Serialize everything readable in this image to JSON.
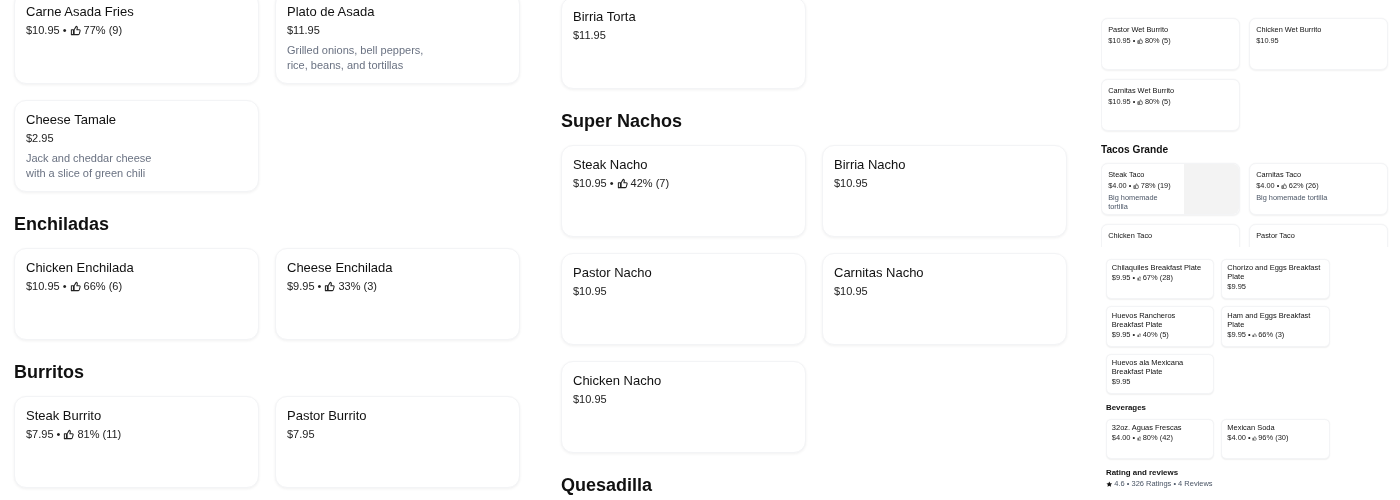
{
  "panels": [
    {
      "sections": [
        {
          "items": [
            {
              "name": "Carne Asada Fries",
              "price": "$10.95 •",
              "rating": "77% (9)"
            },
            {
              "name": "Plato de Asada",
              "price": "$11.95",
              "description": "Grilled onions, bell peppers, rice, beans, and tortillas"
            },
            {
              "name": "Cheese Tamale",
              "price": "$2.95",
              "description": "Jack and cheddar cheese with a slice of green chili"
            }
          ]
        },
        {
          "heading": "Enchiladas",
          "items": [
            {
              "name": "Chicken Enchilada",
              "price": "$10.95 •",
              "rating": "66% (6)"
            },
            {
              "name": "Cheese Enchilada",
              "price": "$9.95 •",
              "rating": "33% (3)"
            }
          ]
        },
        {
          "heading": "Burritos",
          "items": [
            {
              "name": "Steak Burrito",
              "price": "$7.95 •",
              "rating": "81% (11)"
            },
            {
              "name": "Pastor Burrito",
              "price": "$7.95"
            }
          ]
        }
      ]
    },
    {
      "sections": [
        {
          "items": [
            {
              "name": "Birria Torta",
              "price": "$11.95"
            }
          ]
        },
        {
          "heading": "Super Nachos",
          "items": [
            {
              "name": "Steak Nacho",
              "price": "$10.95 •",
              "rating": "42% (7)"
            },
            {
              "name": "Birria Nacho",
              "price": "$10.95"
            },
            {
              "name": "Pastor Nacho",
              "price": "$10.95"
            },
            {
              "name": "Carnitas Nacho",
              "price": "$10.95"
            },
            {
              "name": "Chicken Nacho",
              "price": "$10.95"
            }
          ]
        },
        {
          "heading": "Quesadilla"
        }
      ]
    }
  ],
  "preview": {
    "upper": {
      "sections": [
        {
          "items": [
            {
              "name": "Pastor Wet Burrito",
              "price": "$10.95 •",
              "rating": "80% (5)"
            },
            {
              "name": "Chicken Wet Burrito",
              "price": "$10.95"
            },
            {
              "name": "Carnitas Wet Burrito",
              "price": "$10.95 •",
              "rating": "80% (5)"
            }
          ]
        },
        {
          "heading": "Tacos Grande",
          "items": [
            {
              "name": "Steak Taco",
              "price": "$4.00 •",
              "rating": "78% (19)",
              "description": "Big homemade tortilla",
              "photo": true
            },
            {
              "name": "Carnitas Taco",
              "price": "$4.00 •",
              "rating": "62% (26)",
              "description": "Big homemade tortilla"
            },
            {
              "name": "Chicken Taco"
            },
            {
              "name": "Pastor Taco"
            }
          ]
        }
      ]
    },
    "lower": {
      "sections": [
        {
          "items": [
            {
              "name": "Chilaquiles Breakfast Plate",
              "price": "$9.95 •",
              "rating": "67% (28)"
            },
            {
              "name": "Chorizo and Eggs Breakfast Plate",
              "price": "$9.95"
            },
            {
              "name": "Huevos Rancheros Breakfast Plate",
              "price": "$9.95 •",
              "rating": "40% (5)"
            },
            {
              "name": "Ham and Eggs Breakfast Plate",
              "price": "$9.95 •",
              "rating": "66% (3)"
            },
            {
              "name": "Huevos ala Mexicana Breakfast Plate",
              "price": "$9.95"
            }
          ]
        },
        {
          "heading": "Beverages",
          "items": [
            {
              "name": "32oz. Aguas Frescas",
              "price": "$4.00 •",
              "rating": "80% (42)"
            },
            {
              "name": "Mexican Soda",
              "price": "$4.00 •",
              "rating": "96% (30)"
            }
          ]
        }
      ],
      "reviews": {
        "heading": "Rating and reviews",
        "summary": "4.6 • 326 Ratings • 4 Reviews"
      }
    }
  }
}
